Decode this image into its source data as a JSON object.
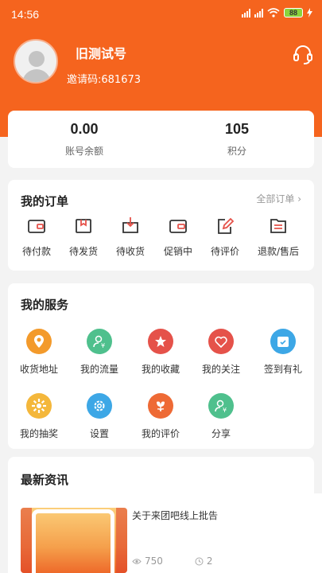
{
  "status_bar": {
    "time": "14:56",
    "network": "4G",
    "battery": "88"
  },
  "profile": {
    "nickname": "旧测试号",
    "invite_code": "邀请码:681673"
  },
  "account": {
    "balance_value": "0.00",
    "balance_label": "账号余额",
    "points_value": "105",
    "points_label": "积分"
  },
  "orders": {
    "title": "我的订单",
    "all_label": "全部订单 ›",
    "items": [
      {
        "label": "待付款",
        "icon": "wallet-icon"
      },
      {
        "label": "待发货",
        "icon": "package-icon"
      },
      {
        "label": "待收货",
        "icon": "receive-box-icon"
      },
      {
        "label": "促销中",
        "icon": "promo-wallet-icon"
      },
      {
        "label": "待评价",
        "icon": "edit-icon"
      },
      {
        "label": "退款/售后",
        "icon": "refund-list-icon"
      }
    ]
  },
  "services": {
    "title": "我的服务",
    "items": [
      {
        "label": "收货地址",
        "icon": "location-pin-icon",
        "color": "#f39a2b"
      },
      {
        "label": "我的流量",
        "icon": "user-yen-icon",
        "color": "#4fc08d"
      },
      {
        "label": "我的收藏",
        "icon": "star-icon",
        "color": "#e5524a"
      },
      {
        "label": "我的关注",
        "icon": "heart-icon",
        "color": "#e5524a"
      },
      {
        "label": "签到有礼",
        "icon": "calendar-check-icon",
        "color": "#3da7e6"
      },
      {
        "label": "我的抽奖",
        "icon": "sun-wheel-icon",
        "color": "#f4b73b"
      },
      {
        "label": "设置",
        "icon": "gear-icon",
        "color": "#3da7e6"
      },
      {
        "label": "我的评价",
        "icon": "flower-icon",
        "color": "#ee6a35"
      },
      {
        "label": "分享",
        "icon": "user-yen-icon",
        "color": "#4fc08d"
      }
    ]
  },
  "news": {
    "title": "最新资讯",
    "item": {
      "title": "关于来团吧线上批告",
      "views": "750",
      "time": "2"
    }
  },
  "colors": {
    "brand": "#f5641e"
  }
}
